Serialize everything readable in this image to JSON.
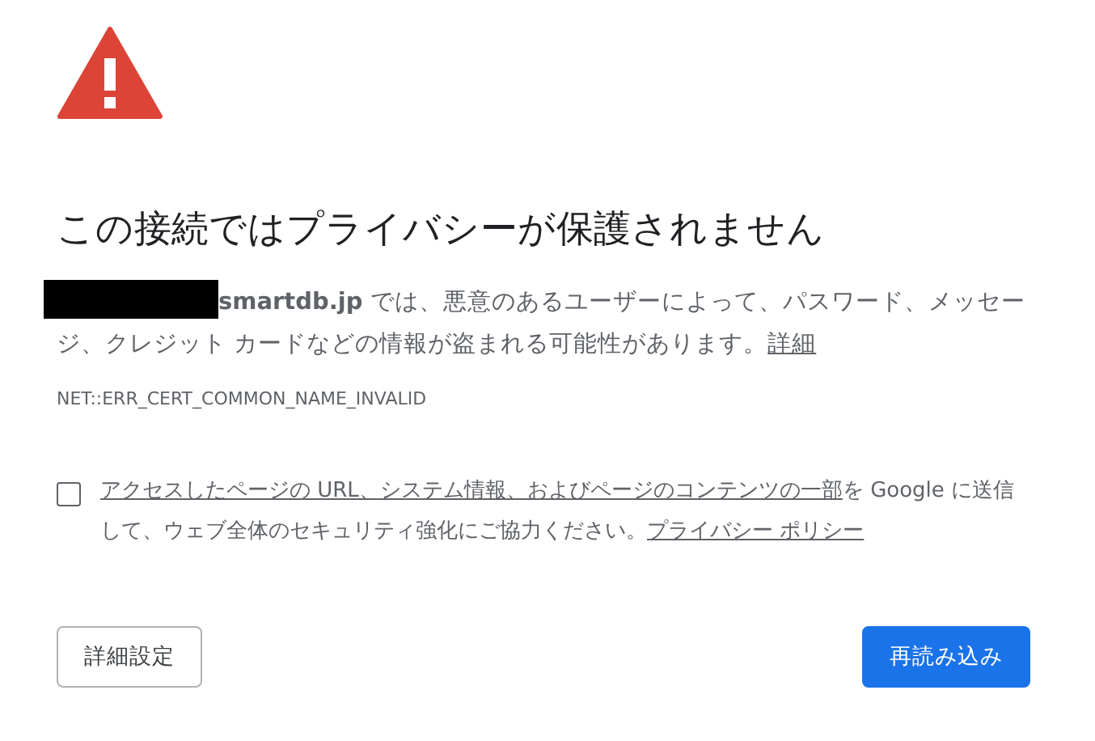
{
  "title": "この接続ではプライバシーが保護されません",
  "message": {
    "redacted": true,
    "text": "**smartdb.jp** では、悪意のあるユーザーによって、パスワード、メッセージ、クレジット カードなどの情報が盗まれる可能性があります。",
    "link": "詳細"
  },
  "error_code": "NET::ERR_CERT_COMMON_NAME_INVALID",
  "consent": {
    "checked": false,
    "link": "アクセスしたページの URL、システム情報、およびページのコンテンツの一部",
    "text": "を Google に送信して、ウェブ全体のセキュリティ強化にご協力ください。",
    "policy_link": "プライバシー ポリシー"
  },
  "buttons": [
    {
      "kind": "secondary",
      "label": "詳細設定"
    },
    {
      "kind": "primary",
      "label": "再読み込み"
    }
  ]
}
